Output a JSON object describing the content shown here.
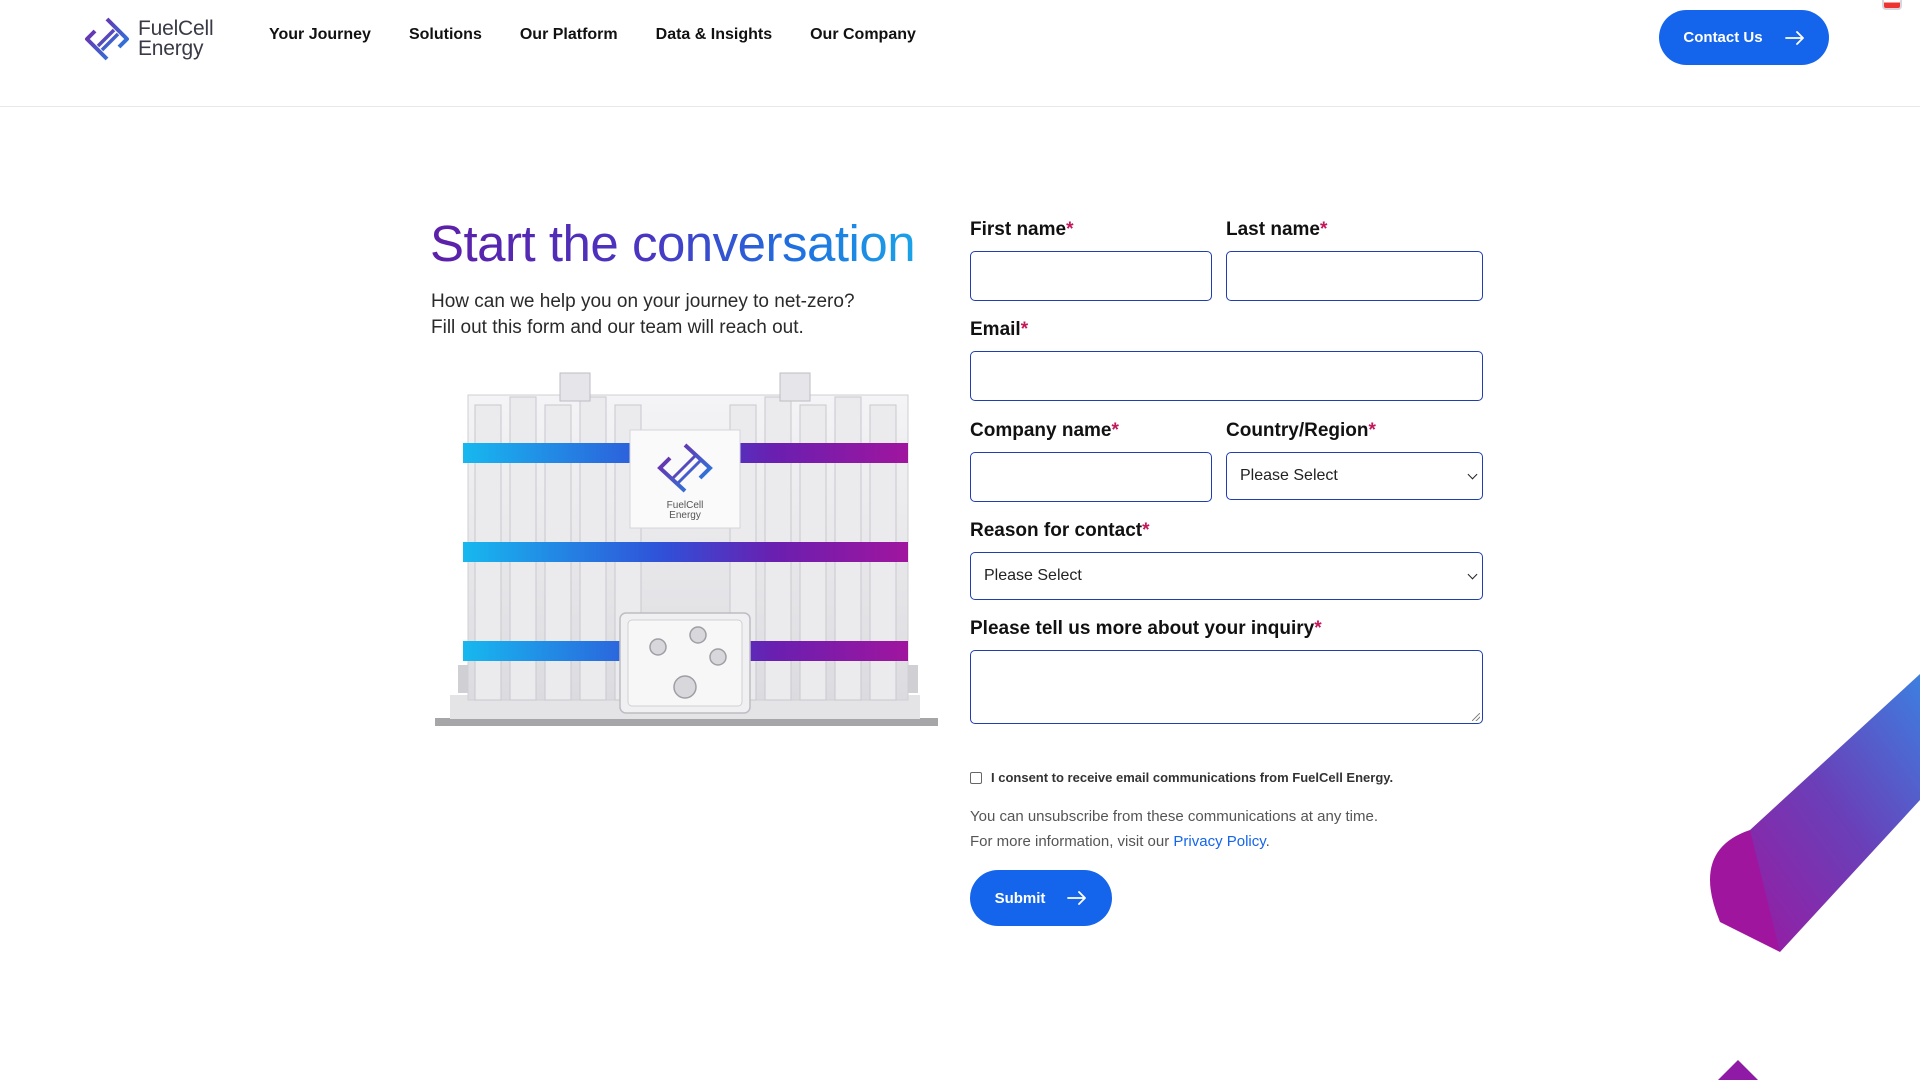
{
  "brand": {
    "line1": "FuelCell",
    "line2": "Energy",
    "accent": "#1565ec",
    "required_color": "#c2185b"
  },
  "nav": {
    "items": [
      {
        "label": "Your Journey"
      },
      {
        "label": "Solutions"
      },
      {
        "label": "Our Platform"
      },
      {
        "label": "Data & Insights"
      },
      {
        "label": "Our Company"
      }
    ],
    "contact_label": "Contact Us",
    "flag_icon": "us-flag-icon"
  },
  "hero": {
    "title": "Start the conversation",
    "subtitle_line1": "How can we help you on your journey to net-zero?",
    "subtitle_line2": "Fill out this form and our team will reach out.",
    "illustration_logo_line1": "FuelCell",
    "illustration_logo_line2": "Energy"
  },
  "form": {
    "required_mark": "*",
    "first_name": {
      "label": "First name",
      "value": ""
    },
    "last_name": {
      "label": "Last name",
      "value": ""
    },
    "email": {
      "label": "Email",
      "value": ""
    },
    "company": {
      "label": "Company name",
      "value": ""
    },
    "country": {
      "label": "Country/Region",
      "selected": "Please Select"
    },
    "reason": {
      "label": "Reason for contact",
      "selected": "Please Select"
    },
    "inquiry": {
      "label": "Please tell us more about your inquiry",
      "value": ""
    },
    "consent": {
      "label": "I consent to receive email communications from FuelCell Energy.",
      "checked": false
    },
    "note_line1": "You can unsubscribe from these communications at any time.",
    "note_line2_prefix": "For more information, visit our ",
    "privacy_link": "Privacy Policy",
    "note_line2_suffix": ".",
    "submit_label": "Submit"
  }
}
